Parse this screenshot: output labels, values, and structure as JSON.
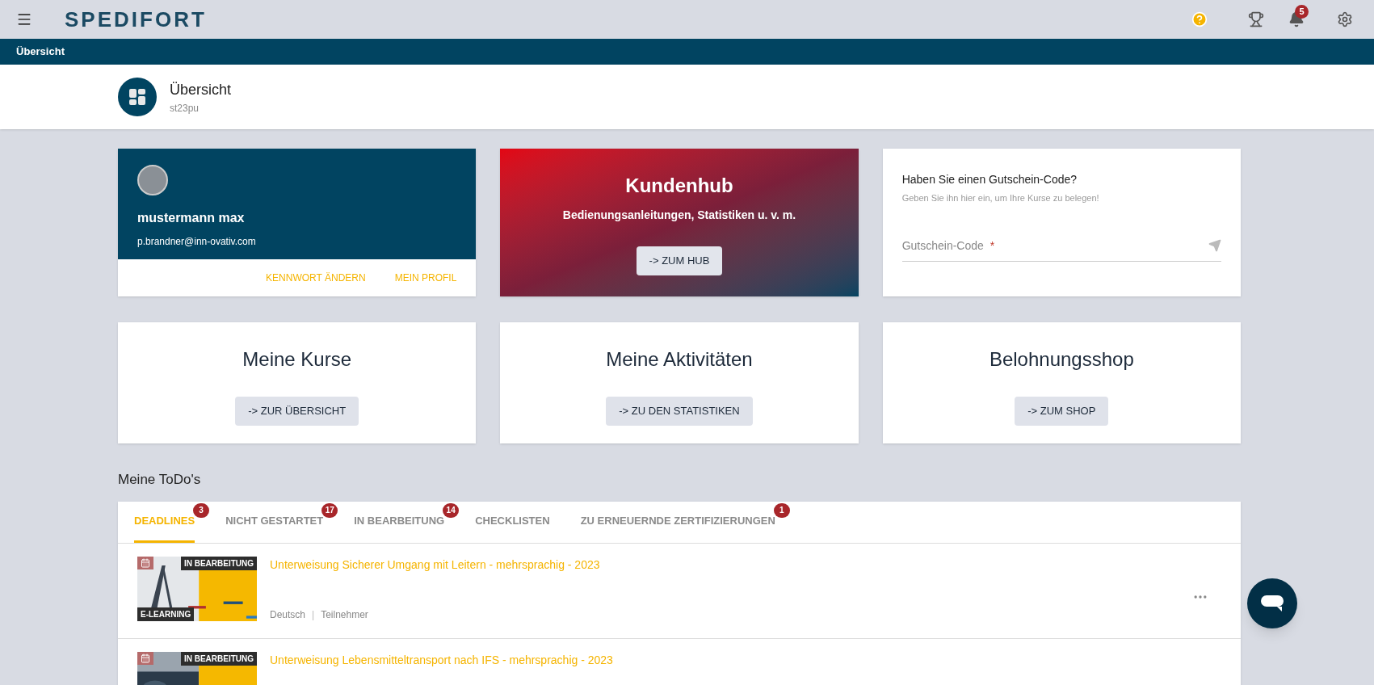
{
  "topbar": {
    "logo": "SPEDIFORT",
    "notification_count": "5"
  },
  "breadcrumb": "Übersicht",
  "header": {
    "title": "Übersicht",
    "subtitle": "st23pu"
  },
  "profile": {
    "name": "mustermann max",
    "email": "p.brandner@inn-ovativ.com",
    "links": [
      "KENNWORT ÄNDERN",
      "MEIN PROFIL"
    ]
  },
  "hub": {
    "title": "Kundenhub",
    "subtitle": "Bedienungsanleitungen, Statistiken u. v. m.",
    "button": "-> ZUM HUB"
  },
  "voucher": {
    "title": "Haben Sie einen Gutschein-Code?",
    "hint": "Geben Sie ihn hier ein, um Ihre Kurse zu belegen!",
    "placeholder": "Gutschein-Code",
    "required_mark": "*"
  },
  "tiles": [
    {
      "title": "Meine Kurse",
      "button": "-> ZUR ÜBERSICHT"
    },
    {
      "title": "Meine Aktivitäten",
      "button": "-> ZU DEN STATISTIKEN"
    },
    {
      "title": "Belohnungsshop",
      "button": "-> ZUM SHOP"
    }
  ],
  "todos": {
    "heading": "Meine ToDo's",
    "tabs": [
      {
        "label": "DEADLINES",
        "count": "3",
        "selected": true
      },
      {
        "label": "NICHT GESTARTET",
        "count": "17",
        "selected": false
      },
      {
        "label": "IN BEARBEITUNG",
        "count": "14",
        "selected": false
      },
      {
        "label": "CHECKLISTEN",
        "selected": false
      },
      {
        "label": "ZU ERNEUERNDE ZERTIFIZIERUNGEN",
        "count": "1",
        "selected": false
      }
    ],
    "items": [
      {
        "title": "Unterweisung Sicherer Umgang mit Leitern - mehrsprachig - 2023",
        "status": "IN BEARBEITUNG",
        "type": "E-LEARNING",
        "language": "Deutsch",
        "separator": "|",
        "role": "Teilnehmer"
      },
      {
        "title": "Unterweisung Lebensmitteltransport nach IFS - mehrsprachig - 2023",
        "status": "IN BEARBEITUNG"
      }
    ]
  }
}
